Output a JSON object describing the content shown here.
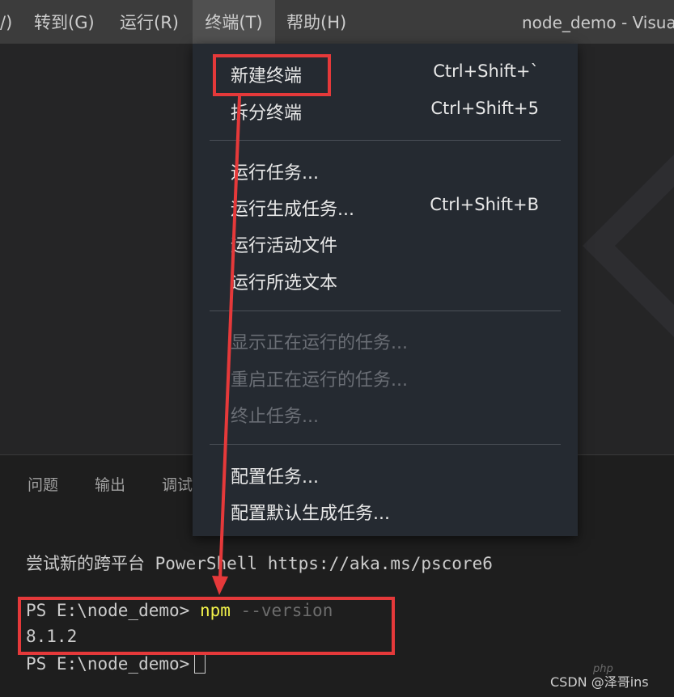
{
  "menubar": {
    "items": [
      {
        "label": "/)"
      },
      {
        "label": "转到(G)"
      },
      {
        "label": "运行(R)"
      },
      {
        "label": "终端(T)"
      },
      {
        "label": "帮助(H)"
      }
    ],
    "window_title": "node_demo - Visual"
  },
  "terminal_menu": {
    "groups": [
      [
        {
          "label": "新建终端",
          "shortcut": "Ctrl+Shift+`"
        },
        {
          "label": "拆分终端",
          "shortcut": "Ctrl+Shift+5"
        }
      ],
      [
        {
          "label": "运行任务...",
          "shortcut": ""
        },
        {
          "label": "运行生成任务...",
          "shortcut": "Ctrl+Shift+B"
        },
        {
          "label": "运行活动文件",
          "shortcut": ""
        },
        {
          "label": "运行所选文本",
          "shortcut": ""
        }
      ],
      [
        {
          "label": "显示正在运行的任务...",
          "shortcut": "",
          "disabled": true
        },
        {
          "label": "重启正在运行的任务...",
          "shortcut": "",
          "disabled": true
        },
        {
          "label": "终止任务...",
          "shortcut": "",
          "disabled": true
        }
      ],
      [
        {
          "label": "配置任务...",
          "shortcut": ""
        },
        {
          "label": "配置默认生成任务...",
          "shortcut": ""
        }
      ]
    ]
  },
  "panel": {
    "tabs": [
      "问题",
      "输出",
      "调试"
    ],
    "terminal": {
      "banner": "尝试新的跨平台 PowerShell https://aka.ms/pscore6",
      "prompt": "PS E:\\node_demo>",
      "command": "npm",
      "flag": "--version",
      "output": "8.1.2",
      "prompt2": "PS E:\\node_demo>"
    }
  },
  "footer": {
    "credit": "CSDN @泽哥ins",
    "logo_text": "php"
  },
  "colors": {
    "annotation": "#e5393a",
    "menu_bg": "#252a31",
    "titlebar_bg": "#3c3c3c"
  }
}
